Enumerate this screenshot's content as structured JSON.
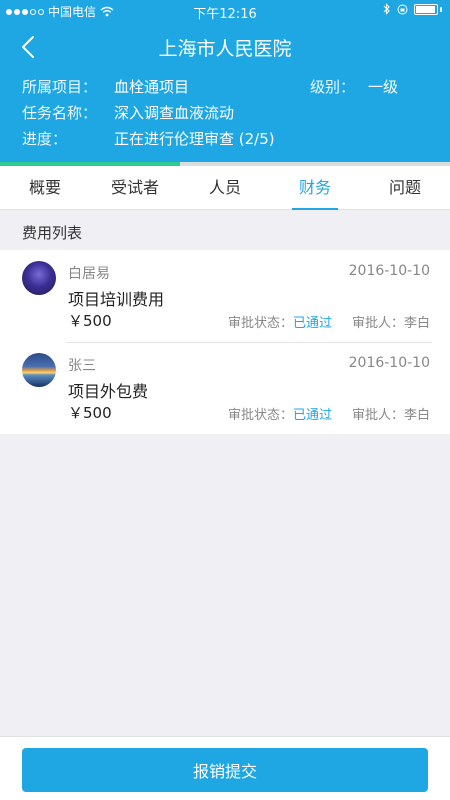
{
  "status_bar": {
    "carrier": "中国电信",
    "time": "下午12:16"
  },
  "header": {
    "title": "上海市人民医院",
    "project_label": "所属项目：",
    "project_value": "血栓通项目",
    "level_label": "级别：",
    "level_value": "一级",
    "task_label": "任务名称：",
    "task_value": "深入调查血液流动",
    "progress_label": "进度：",
    "progress_value": "正在进行伦理审查 (2/5)",
    "progress_fraction": 0.4
  },
  "tabs": [
    {
      "label": "概要",
      "active": false
    },
    {
      "label": "受试者",
      "active": false
    },
    {
      "label": "人员",
      "active": false
    },
    {
      "label": "财务",
      "active": true
    },
    {
      "label": "问题",
      "active": false
    }
  ],
  "section_title": "费用列表",
  "expenses": [
    {
      "name": "白居易",
      "date": "2016-10-10",
      "fee": "项目培训费用",
      "amount": "￥500",
      "status_label": "审批状态：",
      "status": "已通过",
      "approver_label": "审批人：",
      "approver": "李白"
    },
    {
      "name": "张三",
      "date": "2016-10-10",
      "fee": "项目外包费",
      "amount": "￥500",
      "status_label": "审批状态：",
      "status": "已通过",
      "approver_label": "审批人：",
      "approver": "李白"
    }
  ],
  "submit_label": "报销提交",
  "colors": {
    "primary": "#1fa7e4",
    "progress": "#2ecc8e"
  }
}
